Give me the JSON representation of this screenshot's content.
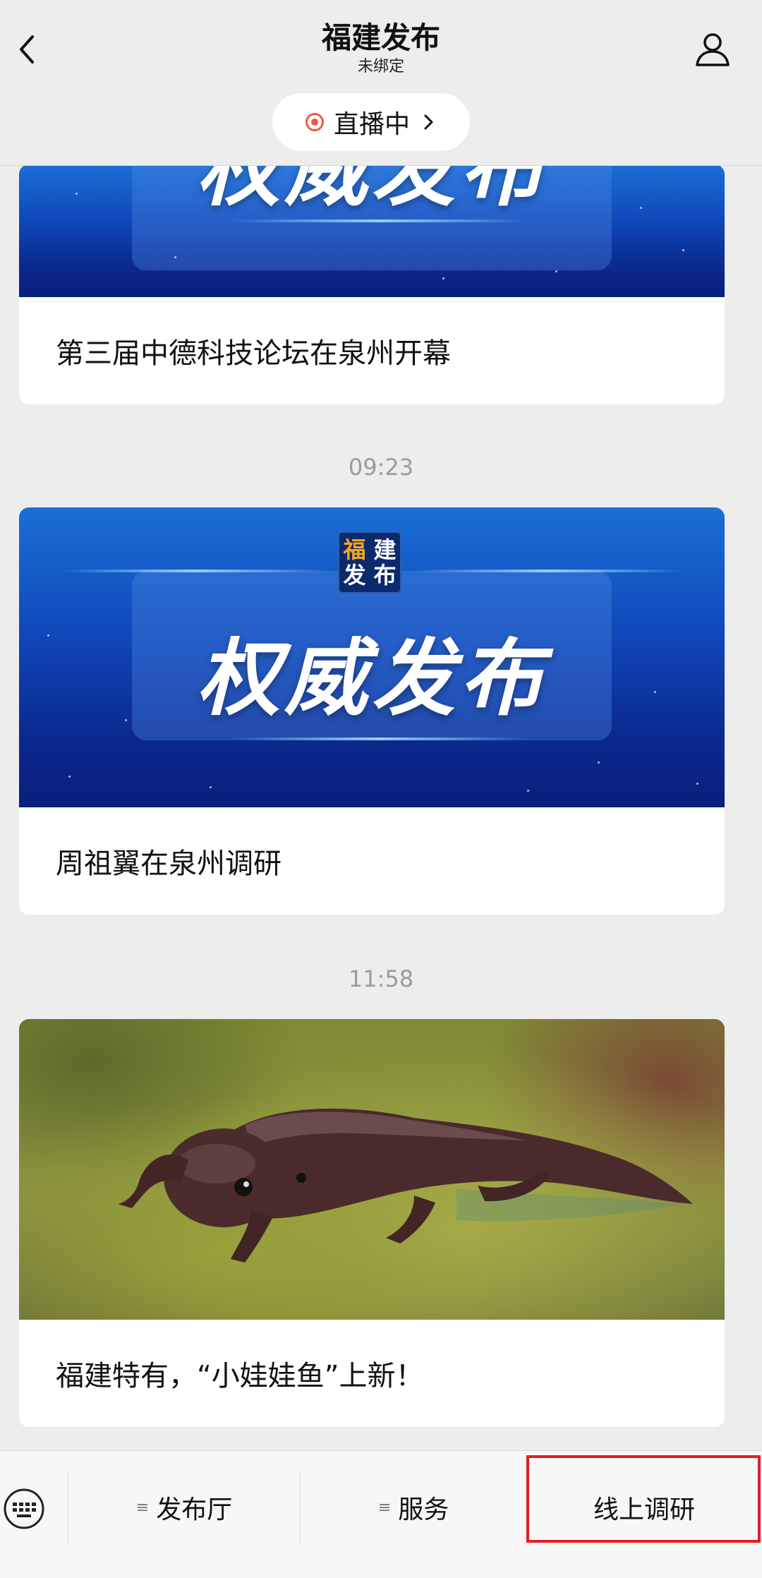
{
  "header": {
    "title": "福建发布",
    "subtitle": "未绑定",
    "live_label": "直播中"
  },
  "banner_text": "权威发布",
  "banner_logo_text": [
    "福",
    "建",
    "发",
    "布"
  ],
  "feed": {
    "items": [
      {
        "title": "第三届中德科技论坛在泉州开幕"
      },
      {
        "timestamp": "09:23",
        "title": "周祖翼在泉州调研"
      },
      {
        "timestamp": "11:58",
        "title": "福建特有，“小娃娃鱼”上新！"
      }
    ]
  },
  "bottom_menu": {
    "tabs": [
      {
        "label": "发布厅",
        "has_submenu": true
      },
      {
        "label": "服务",
        "has_submenu": true
      },
      {
        "label": "线上调研",
        "has_submenu": false
      }
    ]
  },
  "colors": {
    "background": "#ededed",
    "live_dot": "#f05a3e",
    "highlight": "#e51c23",
    "banner_blue": "#0f45b8"
  },
  "icons": [
    "back-chevron-icon",
    "profile-icon",
    "live-dot-icon",
    "chevron-right-icon",
    "keyboard-icon",
    "menu-list-icon"
  ]
}
